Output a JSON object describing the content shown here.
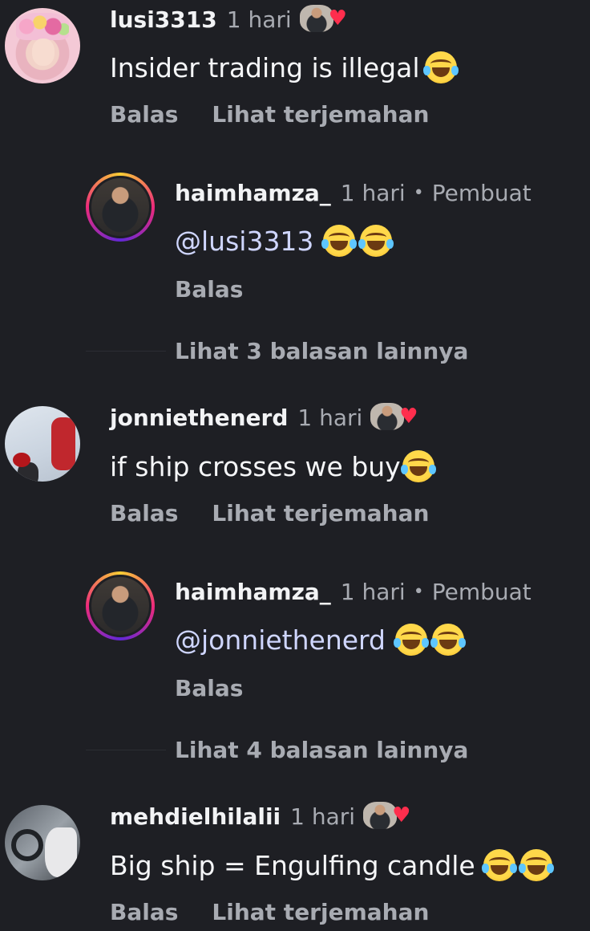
{
  "comments": [
    {
      "username": "lusi3313",
      "time": "1 hari",
      "text": "Insider trading is illegal",
      "emoji_count": 1,
      "reply_label": "Balas",
      "translate_label": "Lihat terjemahan"
    },
    {
      "username": "jonniethenerd",
      "time": "1 hari",
      "text": "if ship crosses we buy",
      "emoji_count": 1,
      "reply_label": "Balas",
      "translate_label": "Lihat terjemahan"
    },
    {
      "username": "mehdielhilalii",
      "time": "1 hari",
      "text": "Big ship = Engulfing candle",
      "emoji_count": 2,
      "reply_label": "Balas",
      "translate_label": "Lihat terjemahan"
    }
  ],
  "replies": [
    {
      "username": "haimhamza_",
      "time": "1 hari",
      "separator": "•",
      "creator_label": "Pembuat",
      "mention": "@lusi3313",
      "emoji_count": 2,
      "reply_label": "Balas",
      "more_replies": "Lihat 3 balasan lainnya"
    },
    {
      "username": "haimhamza_",
      "time": "1 hari",
      "separator": "•",
      "creator_label": "Pembuat",
      "mention": "@jonniethenerd",
      "emoji_count": 2,
      "reply_label": "Balas",
      "more_replies": "Lihat 4 balasan lainnya"
    }
  ],
  "icons": {
    "creator_like": "creator-liked-heart-icon",
    "emoji": "face-with-tears-of-joy-emoji"
  },
  "colors": {
    "background": "#1e1f24",
    "heart": "#ff2e4d",
    "secondary_text": "#a8abb2"
  }
}
